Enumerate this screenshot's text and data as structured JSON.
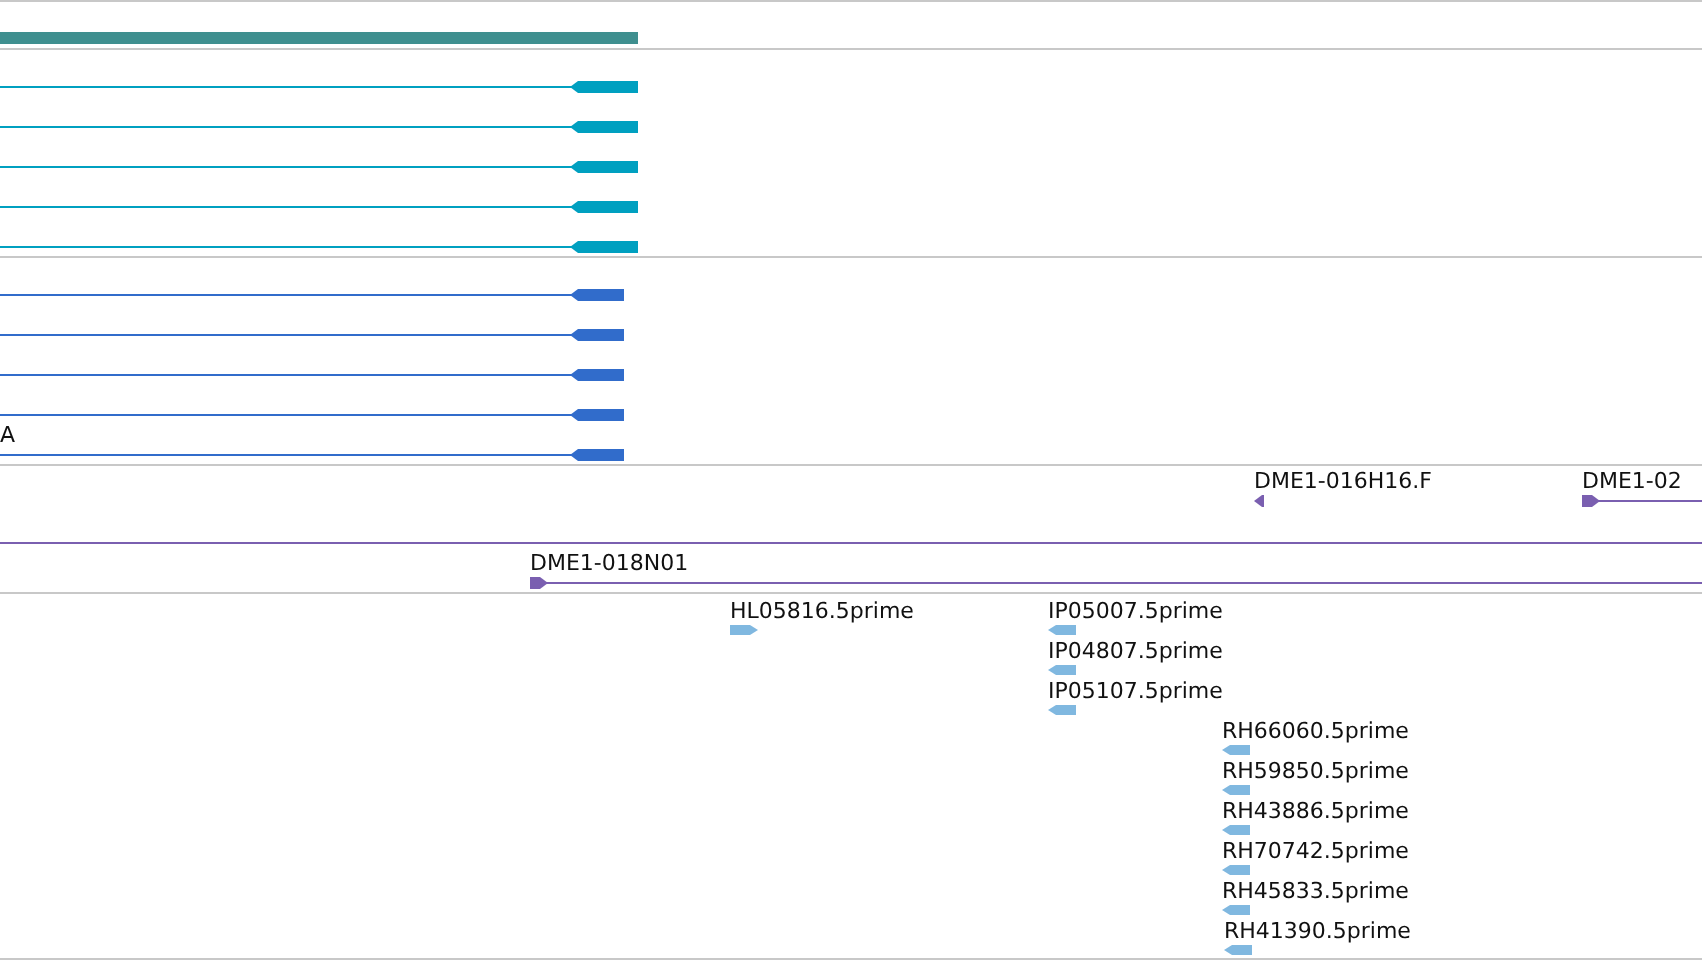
{
  "tracks": [
    {
      "kind": "bar",
      "color": "#3f8f8f"
    },
    {
      "kind": "transcripts",
      "color": "#00a0c0",
      "features": [
        {
          "reverse": true
        },
        {
          "reverse": true
        },
        {
          "reverse": true
        },
        {
          "reverse": true
        },
        {
          "reverse": true
        }
      ]
    },
    {
      "kind": "transcripts",
      "color": "#316ccb",
      "features": [
        {
          "reverse": true
        },
        {
          "reverse": true
        },
        {
          "reverse": true
        },
        {
          "reverse": true
        },
        {
          "reverse": true,
          "label": "A"
        }
      ]
    },
    {
      "kind": "clones",
      "color": "#7a5fb0",
      "features": [
        {
          "label": "DME1-016H16.F",
          "reverse": true
        },
        {
          "label": "DME1-02",
          "reverse": false
        }
      ]
    },
    {
      "kind": "clones",
      "color": "#7a5fb0",
      "features": [
        {
          "label": "DME1-018N01",
          "reverse": false
        }
      ]
    },
    {
      "kind": "ests",
      "color": "#80b8e0",
      "features": [
        {
          "label": "HL05816.5prime",
          "reverse": false
        },
        {
          "label": "IP05007.5prime",
          "reverse": true
        },
        {
          "label": "IP04807.5prime",
          "reverse": true
        },
        {
          "label": "IP05107.5prime",
          "reverse": true
        },
        {
          "label": "RH66060.5prime",
          "reverse": true
        },
        {
          "label": "RH59850.5prime",
          "reverse": true
        },
        {
          "label": "RH43886.5prime",
          "reverse": true
        },
        {
          "label": "RH70742.5prime",
          "reverse": true
        },
        {
          "label": "RH45833.5prime",
          "reverse": true
        },
        {
          "label": "RH41390.5prime",
          "reverse": true
        }
      ]
    }
  ]
}
